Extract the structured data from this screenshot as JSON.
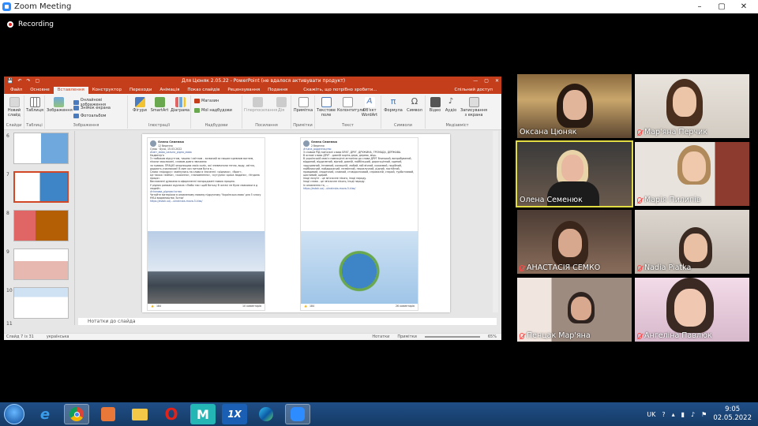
{
  "window": {
    "title": "Zoom Meeting",
    "controls": [
      "–",
      "▢",
      "✕"
    ]
  },
  "recording": {
    "label": "Recording"
  },
  "ppt": {
    "quick_access": [
      "💾",
      "↶",
      "↷",
      "▢"
    ],
    "doc_title": "Для Цюняк 2.05.22 - PowerPoint (не вдалося активувати продукт)",
    "window_controls": [
      "—",
      "▢",
      "✕"
    ],
    "tabs": [
      "Файл",
      "Основне",
      "Вставлення",
      "Конструктор",
      "Переходи",
      "Анімація",
      "Показ слайдів",
      "Рецензування",
      "Подання"
    ],
    "tell_me": "Скажіть, що потрібно зробити...",
    "share": "Спільний доступ",
    "ribbon": {
      "new_slide": "Новий слайд",
      "table": "Таблиця",
      "images": "Зображення",
      "online_images": "Онлайнові зображення",
      "screenshot": "Знімок екрана",
      "photo_album": "Фотоальбом",
      "shapes": "Фігури",
      "smartart": "SmartArt",
      "diagram": "Діаграма",
      "store": "Магазин",
      "my_addins": "Мої надбудови",
      "hyperlink": "Гіперпосилання",
      "action": "Дія",
      "comment": "Примітка",
      "textbox": "Текстове поле",
      "header_footer": "Колонтитули",
      "wordart": "Об'єкт WordArt",
      "equation": "Формула",
      "symbol": "Символ",
      "video": "Відео",
      "audio": "Аудіо",
      "screen_recording": "Записування з екрана",
      "groups": [
        "Слайди",
        "Таблиці",
        "Зображення",
        "Ілюстрації",
        "Надбудови",
        "Посилання",
        "Примітки",
        "Текст",
        "Символи",
        "Медіавміст"
      ]
    },
    "thumb_numbers": [
      "6",
      "7",
      "8",
      "9",
      "10",
      "11"
    ],
    "notes": "Нотатки до слайда",
    "status_left": "Слайд 7 із 31",
    "status_lang": "українська",
    "status_notes": "Нотатки",
    "status_comments": "Примітки",
    "zoom": "65%",
    "slide": {
      "post1": {
        "name": "Олена Семенюк",
        "meta": "12 березня",
        "lines": [
          "Сумы · Буча, 15.03.2022",
          "#світ_мова_сильна_рідна_мова",
          "Надвечір'я",
          "З глибокою відчуттям, тишею і світлом - зазвичай за нашим кревним вогнем, ніколи заколисані, словом довго звичаємо",
          "за травою. ПРАЦЮ опорнищаю своїх коліс, які зневечнили тепло, воду, світло, додають учасникові! В мин хоч ниткам бути в...",
          "Слова «порядку» замінулись на слова в значенні: «рідника», «брат»,",
          "Це також «війни», «кохання», «напомнення», «кутурна» краса людини», «Ундина праця».",
          "Висловлені думками в оформленні нагороджені новою працею.",
          "У рідних рамкам журнала «Любо так» щоб батьку б читачі не були смаковки в д людей».",
          "#гімнова_рідновсічство",
          "Читайте матеріали в оновленому новому підручнику 'Українська мова' для 5 класу НУШ видавництва 'Асток'",
          "https://astok.ua/...ukrainska-mova-5-klas/"
        ],
        "likes": "184",
        "comments": "10 коментарів"
      },
      "post2": {
        "name": "Олена Семенюк",
        "meta": "2 березня",
        "lines": [
          "#гідна_родинництво",
          "З словом РІД пов'язані слова БРАТ, ДРУГ, ДРУЖИНА, ГРОМАДА, ДЕРЖАВА.",
          "В основі слова ДРУГ - давній корінь дерв, дерево, міць.",
          "В українській мові є повноцінні антоніми до слова ДРУГ близький, випробуваний, відданий, віддалений, вірний, давній, найбільший, дорогоцінний, єдиний, задушевний, інтимний, колишній, любий, мій вічний, кохаємий, надійний, найближчий, найдорожчий, незмінний, нерозлучний, рідний, постійний, правдивий, сердечний, славний, стовідсотковий, справжній, старий, турботливий, щасливий, щирий.",
          "Іноді лозунг - це зв'язочне нікого, іноді народу.",
          "Іноді слова - це зв'язочне нікого, іноді народу.",
          "In оновлення та, ...",
          "https://astok.ua/...ukrainska-mova-5-klas/"
        ],
        "likes": "184",
        "comments": "26 коментарів"
      }
    }
  },
  "participants": [
    {
      "name": "Оксана Цюняк",
      "muted": false
    },
    {
      "name": "Мар'яна Перчик",
      "muted": true
    },
    {
      "name": "Олена Семенюк",
      "muted": false
    },
    {
      "name": "Марія Пилипів",
      "muted": true
    },
    {
      "name": "АНАСТАСІЯ СЕМКО",
      "muted": true
    },
    {
      "name": "Nadia Piatka",
      "muted": true
    },
    {
      "name": "Пенцак Мар'яна",
      "muted": true
    },
    {
      "name": "Ангеліна Павлюк",
      "muted": true
    }
  ],
  "taskbar": {
    "apps": [
      "e",
      "",
      "",
      "",
      "O",
      "M",
      "1X",
      "",
      ""
    ],
    "lang": "UK",
    "time": "9:05",
    "date": "02.05.2022"
  }
}
